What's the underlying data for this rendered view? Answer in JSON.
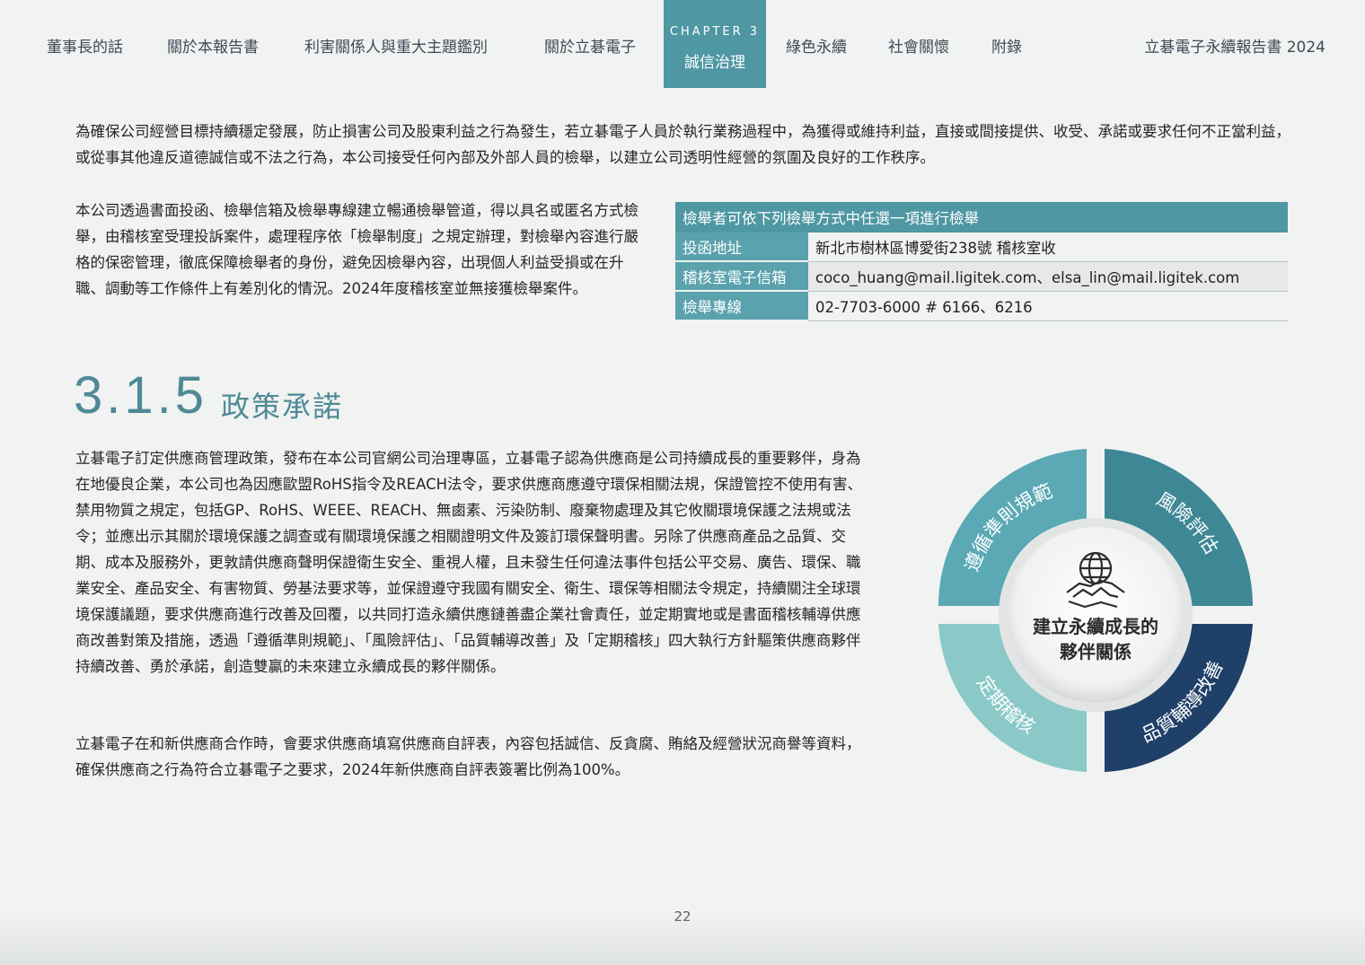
{
  "nav": {
    "items": [
      "董事長的話",
      "關於本報告書",
      "利害關係人與重大主題鑑別",
      "關於立碁電子"
    ],
    "chapter_label": "CHAPTER 3",
    "chapter_name": "誠信治理",
    "items_after": [
      "綠色永續",
      "社會關懷",
      "附錄"
    ],
    "report_title": "立碁電子永續報告書 2024"
  },
  "body": {
    "intro_paragraph": "為確保公司經營目標持續穩定發展，防止損害公司及股東利益之行為發生，若立碁電子人員於執行業務過程中，為獲得或維持利益，直接或間接提供、收受、承諾或要求任何不正當利益，或從事其他違反道德誠信或不法之行為，本公司接受任何內部及外部人員的檢舉，以建立公司透明性經營的氛圍及良好的工作秩序。",
    "whistle_paragraph": "本公司透過書面投函、檢舉信箱及檢舉專線建立暢通檢舉管道，得以具名或匿名方式檢舉，由稽核室受理投訴案件，處理程序依「檢舉制度」之規定辦理，對檢舉內容進行嚴格的保密管理，徹底保障檢舉者的身份，避免因檢舉內容，出現個人利益受損或在升職、調動等工作條件上有差別化的情況。2024年度稽核室並無接獲檢舉案件。",
    "policy_paragraph": "立碁電子訂定供應商管理政策，發布在本公司官網公司治理專區，立碁電子認為供應商是公司持續成長的重要夥伴，身為在地優良企業，本公司也為因應歐盟RoHS指令及REACH法令，要求供應商應遵守環保相關法規，保證管控不使用有害、禁用物質之規定，包括GP、RoHS、WEEE、REACH、無鹵素、污染防制、廢棄物處理及其它攸關環境保護之法規或法令；並應出示其關於環境保護之調查或有關環境保護之相關證明文件及簽訂環保聲明書。另除了供應商產品之品質、交期、成本及服務外，更敦請供應商聲明保證衛生安全、重視人權，且未發生任何違法事件包括公平交易、廣告、環保、職業安全、產品安全、有害物質、勞基法要求等，並保證遵守我國有關安全、衛生、環保等相關法令規定，持續關注全球環境保護議題，要求供應商進行改善及回覆，以共同打造永續供應鏈善盡企業社會責任，並定期實地或是書面稽核輔導供應商改善對策及措施，透過「遵循準則規範」、「風險評估」、「品質輔導改善」及「定期稽核」四大執行方針驅策供應商夥伴持續改善、勇於承諾，創造雙贏的未來建立永續成長的夥伴關係。",
    "self_eval_paragraph": "立碁電子在和新供應商合作時，會要求供應商填寫供應商自評表，內容包括誠信、反貪腐、賄絡及經營狀況商譽等資料，確保供應商之行為符合立碁電子之要求，2024年新供應商自評表簽署比例為100%。"
  },
  "whistle_table": {
    "header": "檢舉者可依下列檢舉方式中任選一項進行檢舉",
    "rows": [
      {
        "label": "投函地址",
        "value": "新北市樹林區博愛街238號 稽核室收"
      },
      {
        "label": "稽核室電子信箱",
        "value": "coco_huang@mail.ligitek.com、elsa_lin@mail.ligitek.com"
      },
      {
        "label": "檢舉專線",
        "value": "02-7703-6000 # 6166、6216"
      }
    ]
  },
  "section": {
    "number": "3.1.5",
    "title": "政策承諾"
  },
  "diagram": {
    "center_line1": "建立永續成長的",
    "center_line2": "夥伴關係",
    "segments": [
      {
        "label": "遵循準則規範",
        "color": "#5aa9b5"
      },
      {
        "label": "風險評估",
        "color": "#3e8795"
      },
      {
        "label": "品質輔導改善",
        "color": "#1f4069"
      },
      {
        "label": "定期稽核",
        "color": "#8ac9c8"
      }
    ],
    "center_icon": "globe-handshake-icon"
  },
  "page_number": "22"
}
